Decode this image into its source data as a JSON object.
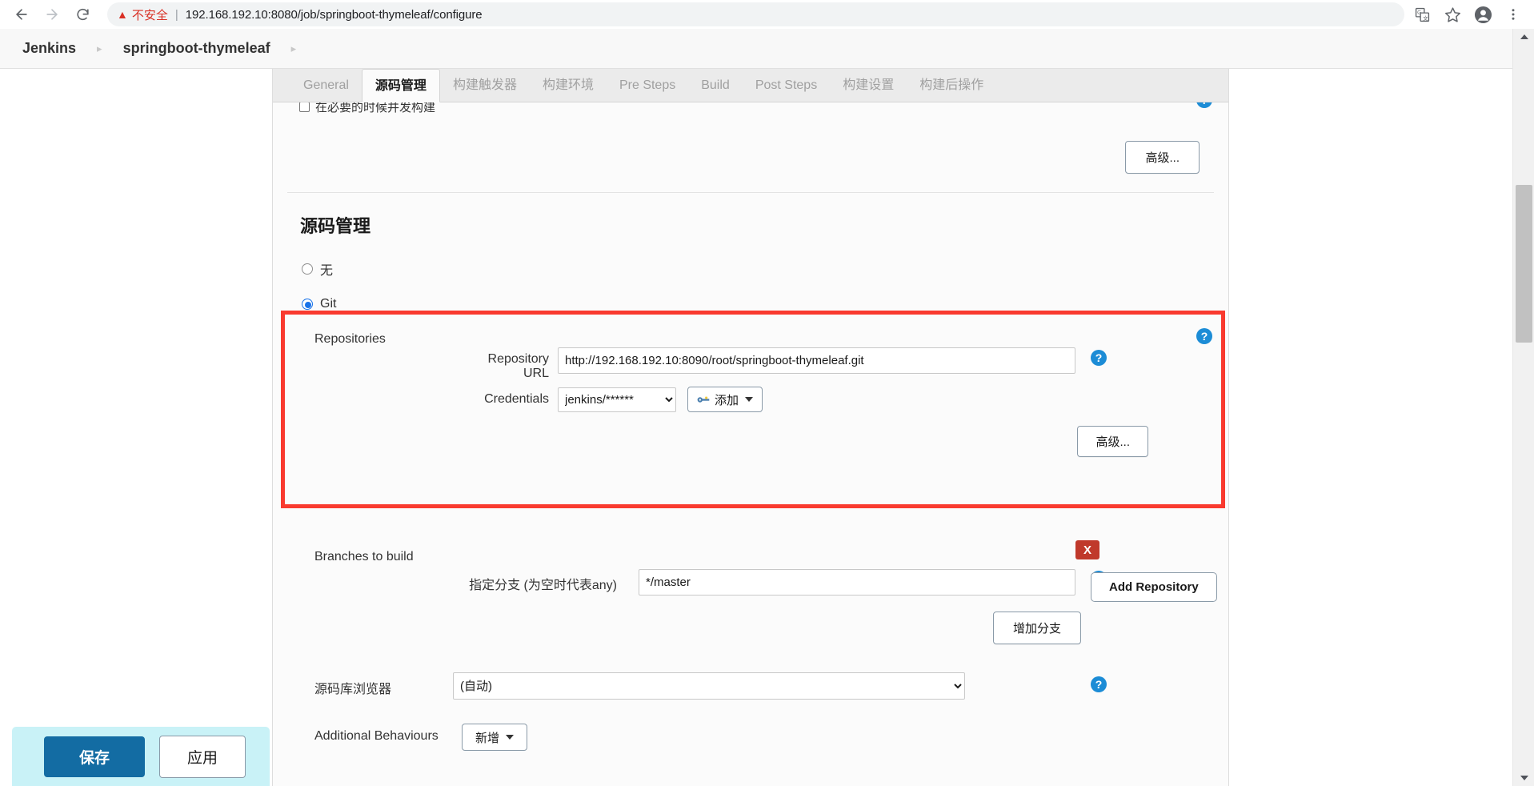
{
  "browser": {
    "back_icon": "arrow-left-icon",
    "forward_icon": "arrow-right-icon",
    "reload_icon": "reload-icon",
    "security_warning": "不安全",
    "url": "192.168.192.10:8080/job/springboot-thymeleaf/configure",
    "url_host": "192.168.192.10",
    "url_rest": ":8080/job/springboot-thymeleaf/configure",
    "translate_icon": "translate-icon",
    "bookmark_icon": "star-icon",
    "profile_icon": "account-avatar-icon",
    "menu_icon": "three-dot-menu-icon"
  },
  "header": {
    "breadcrumb": [
      {
        "label": "Jenkins"
      },
      {
        "label": "springboot-thymeleaf"
      }
    ],
    "separator": "▸"
  },
  "tabs": [
    {
      "label": "General",
      "active": false
    },
    {
      "label": "源码管理",
      "active": true
    },
    {
      "label": "构建触发器",
      "active": false
    },
    {
      "label": "构建环境",
      "active": false
    },
    {
      "label": "Pre Steps",
      "active": false
    },
    {
      "label": "Build",
      "active": false
    },
    {
      "label": "Post Steps",
      "active": false
    },
    {
      "label": "构建设置",
      "active": false
    },
    {
      "label": "构建后操作",
      "active": false
    }
  ],
  "top_section": {
    "concurrent_build_label": "在必要的时候并发构建",
    "advanced_button": "高级..."
  },
  "scm": {
    "section_title": "源码管理",
    "options": [
      {
        "label": "无",
        "selected": false
      },
      {
        "label": "Git",
        "selected": true
      }
    ],
    "repositories": {
      "group_label": "Repositories",
      "url_label": "Repository URL",
      "url_value": "http://192.168.192.10:8090/root/springboot-thymeleaf.git",
      "credentials_label": "Credentials",
      "credentials_value": "jenkins/******",
      "add_credentials_button": "添加",
      "key_icon": "key-icon",
      "advanced_button": "高级...",
      "add_repository_button": "Add Repository"
    },
    "branches": {
      "group_label": "Branches to build",
      "branch_label": "指定分支 (为空时代表any)",
      "branch_value": "*/master",
      "delete_button": "X",
      "add_branch_button": "增加分支"
    },
    "browser": {
      "label": "源码库浏览器",
      "value": "(自动)"
    },
    "additional_behaviours": {
      "label": "Additional Behaviours",
      "add_button": "新增"
    }
  },
  "footer": {
    "save_button": "保存",
    "apply_button": "应用"
  },
  "colors": {
    "accent_blue": "#1c8cd6",
    "highlight_red": "#f93a2f",
    "save_blue": "#136ca3",
    "save_bar_bg": "#c9f2f7",
    "warning_red": "#d93025"
  }
}
